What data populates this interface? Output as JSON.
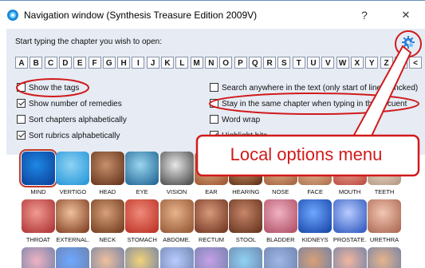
{
  "window": {
    "title": "Navigation window (Synthesis Treasure Edition 2009V)",
    "help_label": "?",
    "close_label": "✕"
  },
  "prompt": "Start typing the chapter you wish to open:",
  "letters": [
    "A",
    "B",
    "C",
    "D",
    "E",
    "F",
    "G",
    "H",
    "I",
    "J",
    "K",
    "L",
    "M",
    "N",
    "O",
    "P",
    "Q",
    "R",
    "S",
    "T",
    "U",
    "V",
    "W",
    "X",
    "Y",
    "Z",
    "...",
    "<"
  ],
  "options_left": [
    {
      "label": "Show the tags",
      "checked": false
    },
    {
      "label": "Show number of remedies",
      "checked": true
    },
    {
      "label": "Sort chapters alphabetically",
      "checked": false
    },
    {
      "label": "Sort rubrics alphabetically",
      "checked": true
    }
  ],
  "options_right": [
    {
      "label": "Search anywhere in the text (only start of line if un",
      "checked": false,
      "tail": "cked)"
    },
    {
      "label": "Stay in the same chapter when typing in the docu",
      "checked": false,
      "tail": "ent"
    },
    {
      "label": "Word wrap",
      "checked": false
    },
    {
      "label": "Highlight hits",
      "checked": true
    }
  ],
  "callout": {
    "text": "Local options menu",
    "color": "#d11a1a"
  },
  "chapters_row1": [
    "MIND",
    "VERTIGO",
    "HEAD",
    "EYE",
    "VISION",
    "EAR",
    "HEARING",
    "NOSE",
    "FACE",
    "MOUTH",
    "TEETH"
  ],
  "chapters_row2": [
    "THROAT",
    "EXTERNAL.",
    "NECK",
    "STOMACH",
    "ABDOME.",
    "RECTUM",
    "STOOL",
    "BLADDER",
    "KIDNEYS",
    "PROSTATE.",
    "URETHRA"
  ],
  "selected_chapter": "MIND",
  "colors": {
    "accent": "#1a73e8",
    "annotation": "#d11a1a",
    "panel": "#e6ebf4"
  },
  "icons": [
    "app-icon",
    "gear-icon",
    "help-icon",
    "close-icon"
  ]
}
